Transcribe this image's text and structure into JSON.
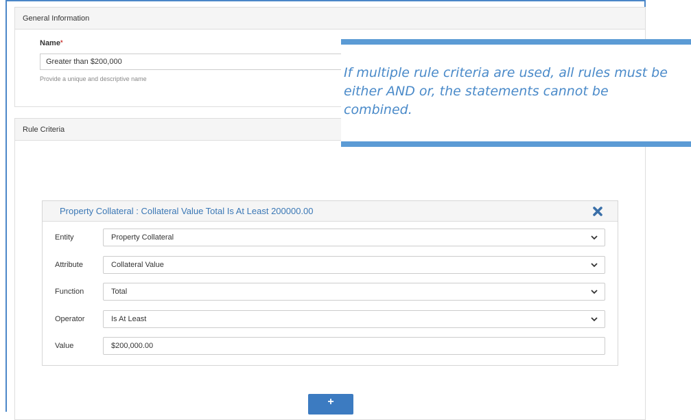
{
  "general": {
    "header": "General Information",
    "name_label": "Name",
    "required_mark": "*",
    "name_value": "Greater than $200,000",
    "name_help": "Provide a unique and descriptive name"
  },
  "rule_criteria": {
    "header": "Rule Criteria",
    "card": {
      "title": "Property Collateral : Collateral Value Total Is At Least 200000.00",
      "remove_icon": "close-icon",
      "fields": [
        {
          "label": "Entity",
          "value": "Property Collateral",
          "kind": "select"
        },
        {
          "label": "Attribute",
          "value": "Collateral Value",
          "kind": "select"
        },
        {
          "label": "Function",
          "value": "Total",
          "kind": "select"
        },
        {
          "label": "Operator",
          "value": "Is At Least",
          "kind": "select"
        },
        {
          "label": "Value",
          "value": "$200,000.00",
          "kind": "input"
        }
      ]
    },
    "add_label": "+"
  },
  "callout": {
    "text": "If multiple rule criteria are used, all rules must be either AND or, the statements cannot be combined."
  },
  "colors": {
    "accent": "#3c7bc1",
    "callout_border": "#5b9bd5",
    "callout_text": "#4a8ac9",
    "frame": "#4a86c8"
  }
}
